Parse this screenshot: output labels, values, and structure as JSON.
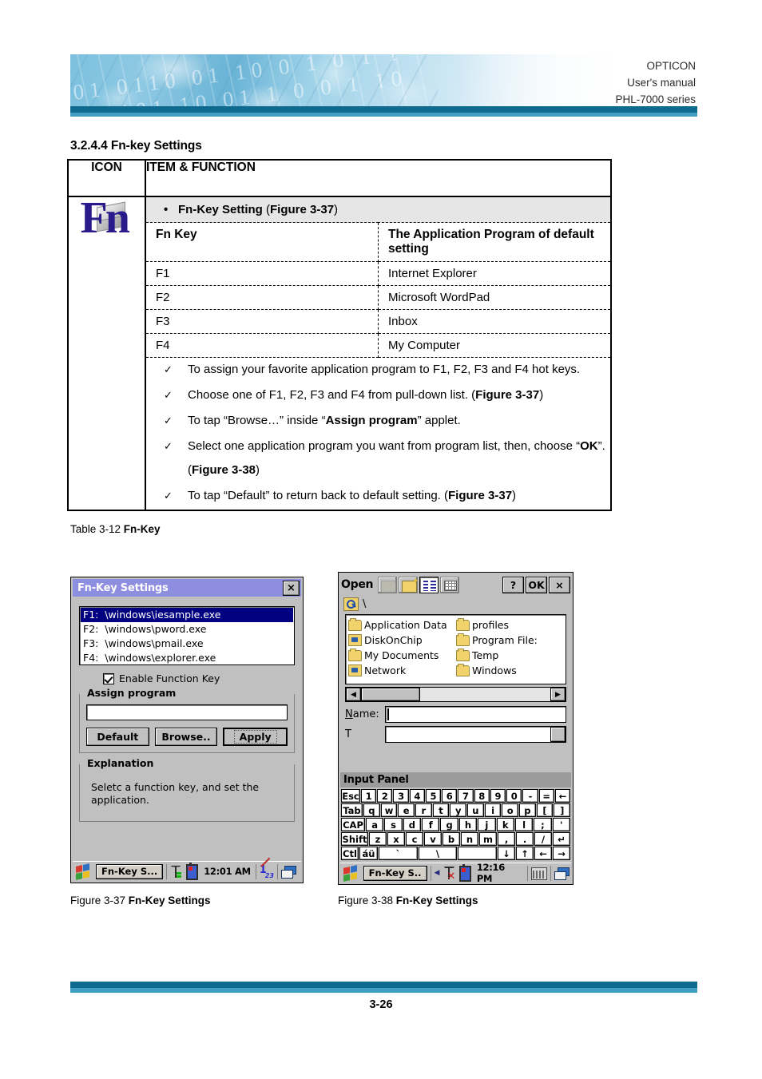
{
  "header": {
    "company": "OPTICON",
    "doc_type": "User's manual",
    "product": "PHL-7000 series"
  },
  "section": {
    "title": "3.2.4.4 Fn-key Settings"
  },
  "main_table": {
    "col_icon_header": "ICON",
    "col_item_header": "ITEM & FUNCTION",
    "icon_name": "fn-key-icon",
    "bullet": {
      "marker": "•",
      "label": "Fn-Key Setting",
      "ref_open": " (",
      "ref": "Figure 3-37",
      "ref_close": ")"
    },
    "fn_table": {
      "headers": [
        "Fn Key",
        "The Application Program of default setting"
      ],
      "rows": [
        [
          "F1",
          "Internet Explorer"
        ],
        [
          "F2",
          "Microsoft WordPad"
        ],
        [
          "F3",
          "Inbox"
        ],
        [
          "F4",
          "My Computer"
        ]
      ]
    },
    "checks": [
      {
        "marker": "✓",
        "parts": [
          {
            "t": "To assign your favorite application program to F1, F2, F3 and F4 hot keys.",
            "b": false
          }
        ]
      },
      {
        "marker": "✓",
        "parts": [
          {
            "t": "Choose one of F1, F2, F3 and F4 from pull-down list. (",
            "b": false
          },
          {
            "t": "Figure 3-37",
            "b": true
          },
          {
            "t": ")",
            "b": false
          }
        ]
      },
      {
        "marker": "✓",
        "parts": [
          {
            "t": "To tap “Browse…” inside “",
            "b": false
          },
          {
            "t": "Assign program",
            "b": true
          },
          {
            "t": "” applet.",
            "b": false
          }
        ]
      },
      {
        "marker": "✓",
        "parts": [
          {
            "t": "Select one application program you want from program list, then, choose “",
            "b": false
          },
          {
            "t": "OK",
            "b": true
          },
          {
            "t": "”. (",
            "b": false
          },
          {
            "t": "Figure 3-38",
            "b": true
          },
          {
            "t": ")",
            "b": false
          }
        ]
      },
      {
        "marker": "✓",
        "parts": [
          {
            "t": "To tap “Default” to return back to default setting. (",
            "b": false
          },
          {
            "t": "Figure 3-37",
            "b": true
          },
          {
            "t": ")",
            "b": false
          }
        ]
      }
    ],
    "caption_prefix": "Table 3-12 ",
    "caption_bold": "Fn-Key"
  },
  "figure37": {
    "title": "Fn-Key Settings",
    "close_label": "×",
    "list_items": [
      "F1:  \\windows\\iesample.exe",
      "F2:  \\windows\\pword.exe",
      "F3:  \\windows\\pmail.exe",
      "F4:  \\windows\\explorer.exe"
    ],
    "selected_index": 0,
    "checkbox_label": "Enable Function Key",
    "checkbox_checked": true,
    "assign_group_label": "Assign program",
    "assign_input_value": "",
    "buttons": [
      "Default",
      "Browse..",
      "Apply"
    ],
    "focused_button": "Apply",
    "explanation_group_label": "Explanation",
    "explanation_text": "Seletc a function key, and set the application.",
    "taskbar": {
      "start_icon": "windows-start-icon",
      "task_button": "Fn-Key S...",
      "tray_icons": [
        "antenna-icon",
        "battery-icon"
      ],
      "time": "12:01 AM",
      "right_icons": [
        "pen-input-icon",
        "windows-stack-icon"
      ]
    },
    "caption_prefix": "Figure 3-37 ",
    "caption_bold": "Fn-Key Settings"
  },
  "figure38": {
    "toolbar": {
      "label": "Open",
      "icons": [
        "up-folder-icon",
        "new-folder-icon",
        "list-view-icon",
        "details-view-icon"
      ],
      "pressed_icon": "list-view-icon",
      "help_label": "?",
      "ok_label": "OK",
      "close_label": "×"
    },
    "path_icon": "find-folder-icon",
    "path": "\\",
    "files": {
      "left": [
        {
          "name": "Application Data",
          "icon": "folder-icon"
        },
        {
          "name": "DiskOnChip",
          "icon": "system-folder-icon"
        },
        {
          "name": "My Documents",
          "icon": "folder-icon"
        },
        {
          "name": "Network",
          "icon": "system-folder-icon"
        }
      ],
      "right": [
        {
          "name": "profiles",
          "icon": "folder-icon"
        },
        {
          "name": "Program File:",
          "icon": "folder-icon"
        },
        {
          "name": "Temp",
          "icon": "folder-icon"
        },
        {
          "name": "Windows",
          "icon": "folder-icon"
        }
      ]
    },
    "scroll_left_label": "◀",
    "scroll_right_label": "▶",
    "name_label": "Name:",
    "name_value": "",
    "type_label": "T",
    "input_panel": {
      "title": "Input Panel",
      "rows": [
        [
          "Esc",
          "1",
          "2",
          "3",
          "4",
          "5",
          "6",
          "7",
          "8",
          "9",
          "0",
          "-",
          "=",
          "←"
        ],
        [
          "Tab",
          "q",
          "w",
          "e",
          "r",
          "t",
          "y",
          "u",
          "i",
          "o",
          "p",
          "[",
          "]"
        ],
        [
          "CAP",
          "a",
          "s",
          "d",
          "f",
          "g",
          "h",
          "j",
          "k",
          "l",
          ";",
          "'"
        ],
        [
          "Shift",
          "z",
          "x",
          "c",
          "v",
          "b",
          "n",
          "m",
          ",",
          ".",
          "/",
          "↵"
        ],
        [
          "Ctl",
          "áü",
          "`",
          "\\",
          " ",
          "↓",
          "↑",
          "←",
          "→"
        ]
      ]
    },
    "taskbar": {
      "start_icon": "windows-start-icon",
      "task_button": "Fn-Key S..",
      "tray_icons": [
        "antenna-disconnected-icon",
        "battery-icon"
      ],
      "time": "12:16 PM",
      "right_icons": [
        "keyboard-icon",
        "windows-stack-icon"
      ]
    },
    "caption_prefix": "Figure 3-38 ",
    "caption_bold": "Fn-Key Settings"
  },
  "footer": {
    "page": "3-26"
  }
}
